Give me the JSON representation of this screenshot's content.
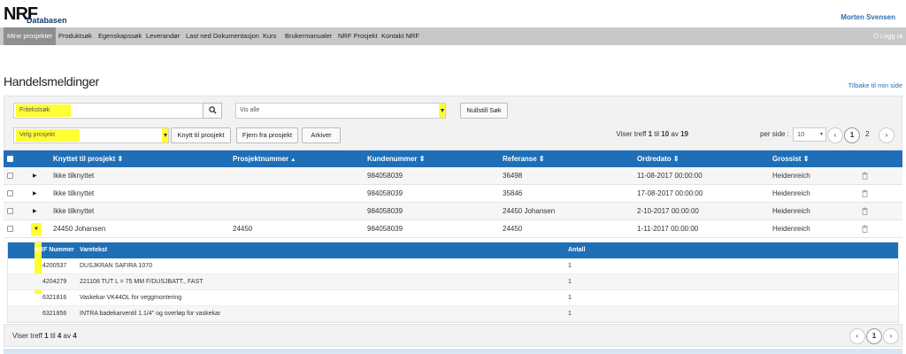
{
  "header": {
    "logo_text": "NRF",
    "logo_sub": "Databasen",
    "user_name": "Morten Svensen"
  },
  "nav": {
    "items": [
      "Mine prosjekter",
      "Produktsøk",
      "Egenskapssøk",
      "Leverandør",
      "Last ned Dokumentasjon",
      "Kurs",
      "Brukermanualer",
      "NRF Prosjekt",
      "Kontakt NRF"
    ],
    "logout": "Logg ut"
  },
  "page": {
    "title": "Handelsmeldinger",
    "back_link": "Tilbake til min side"
  },
  "filters": {
    "search_placeholder": "Fritekstsøk",
    "filter_select": "Vis alle",
    "reset_button": "Nullstill Søk",
    "project_select": "Velg prosjekt",
    "link_button": "Knytt til prosjekt",
    "remove_button": "Fjern fra prosjekt",
    "archive_button": "Arkiver",
    "summary_prefix": "Viser treff ",
    "summary_from": "1",
    "summary_mid1": " til ",
    "summary_to": "10",
    "summary_mid2": " av ",
    "summary_total": "19",
    "per_page_label": "per side :",
    "per_page_value": "10",
    "pages": [
      "1",
      "2"
    ]
  },
  "table": {
    "columns": [
      "Knyttet til prosjekt",
      "Prosjektnummer",
      "Kundenummer",
      "Referanse",
      "Ordredato",
      "Grossist"
    ],
    "sort_icons": [
      "⇕",
      "▲",
      "⇕",
      "⇕",
      "⇕",
      "⇕"
    ],
    "rows": [
      {
        "project": "Ikke tilknyttet",
        "project_no": "",
        "customer_no": "984058039",
        "reference": "36498",
        "order_date": "11-08-2017 00:00:00",
        "wholesaler": "Heidenreich"
      },
      {
        "project": "Ikke tilknyttet",
        "project_no": "",
        "customer_no": "984058039",
        "reference": "35846",
        "order_date": "17-08-2017 00:00:00",
        "wholesaler": "Heidenreich"
      },
      {
        "project": "Ikke tilknyttet",
        "project_no": "",
        "customer_no": "984058039",
        "reference": "24450 Johansen",
        "order_date": "2-10-2017 00:00:00",
        "wholesaler": "Heidenreich"
      },
      {
        "project": "24450 Johansen",
        "project_no": "24450",
        "customer_no": "984058039",
        "reference": "24450",
        "order_date": "1-11-2017 00:00:00",
        "wholesaler": "Heidenreich"
      }
    ]
  },
  "subtable": {
    "columns": [
      "NRF Nummer",
      "Varetekst",
      "Antall"
    ],
    "rows": [
      {
        "nrf": "4200537",
        "text": "DUSJKRAN SAFIRA 1070",
        "qty": "1"
      },
      {
        "nrf": "4204279",
        "text": "221108 TUT L = 75 MM F/DUSJBATT., FAST",
        "qty": "1"
      },
      {
        "nrf": "6321816",
        "text": "Vaskekar VK44OL for veggmontering",
        "qty": "1"
      },
      {
        "nrf": "6321856",
        "text": "INTRA badekarventil 1.1/4\" og overløp for vaskekar",
        "qty": "1"
      }
    ]
  },
  "footer": {
    "summary_prefix": "Viser treff ",
    "summary_from": "1",
    "summary_mid1": " til ",
    "summary_to": "4",
    "summary_mid2": " av ",
    "summary_total": "4",
    "page": "1"
  },
  "colors": {
    "accent": "#1f6fb8",
    "highlight": "#ffff33",
    "nav_bg": "#c8c8c8"
  }
}
